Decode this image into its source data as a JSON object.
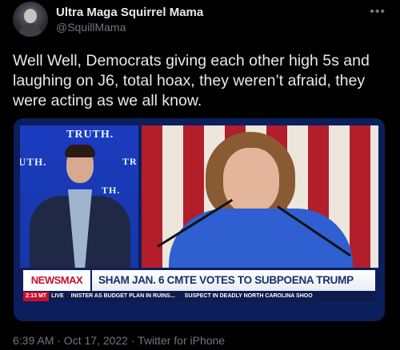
{
  "author": {
    "display_name": "Ultra Maga Squirrel Mama",
    "handle": "@SquillMama"
  },
  "more_icon": "more-horizontal-icon",
  "tweet": {
    "text": "Well Well, Democrats giving each other high 5s and laughing on J6, total hoax, they weren’t afraid, they were acting as we all know."
  },
  "media": {
    "background_signs": [
      "TRUTH.",
      "UTH.",
      "TH.",
      "TR"
    ],
    "ticker": {
      "logo": "NEWSMAX",
      "headline": "SHAM JAN. 6 CMTE VOTES TO SUBPOENA TRUMP",
      "time": "2:13 MT",
      "live": "LIVE",
      "crawl_1": "INISTER AS BUDGET PLAN IN RUINS...",
      "crawl_2": "SUSPECT IN DEADLY NORTH CAROLINA SHOO"
    }
  },
  "meta": {
    "timestamp": "6:39 AM · Oct 17, 2022 · Twitter for iPhone"
  },
  "colors": {
    "background": "#000000",
    "text": "#e7e9ea",
    "secondary": "#71767b",
    "newsmax_red": "#c8102e"
  }
}
